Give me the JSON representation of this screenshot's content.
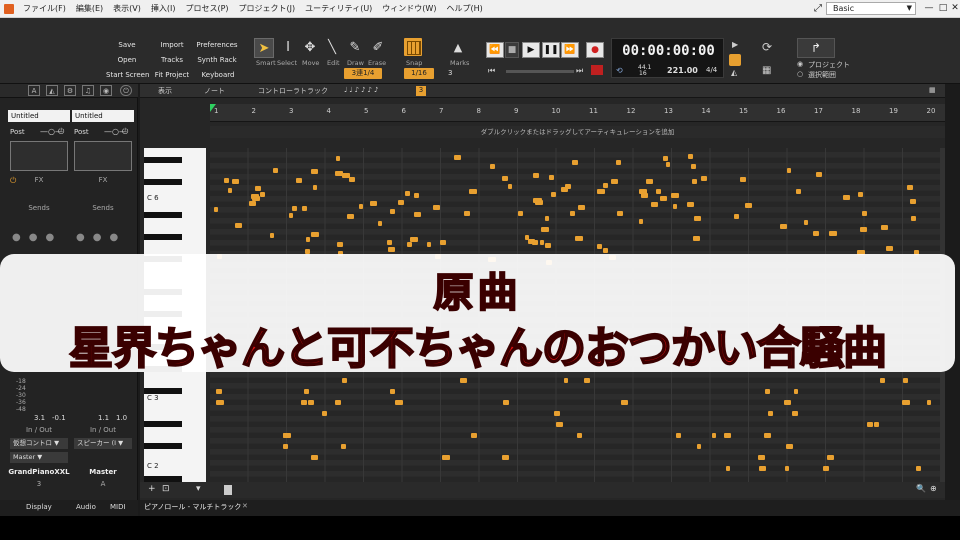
{
  "menubar": {
    "items": [
      "ファイル(F)",
      "編集(E)",
      "表示(V)",
      "挿入(I)",
      "プロセス(P)",
      "プロジェクト(J)",
      "ユーティリティ(U)",
      "ウィンドウ(W)",
      "ヘルプ(H)"
    ],
    "workspace": "Basic"
  },
  "controlbar": {
    "module_buttons": [
      "Save",
      "Import",
      "Preferences",
      "Open",
      "Tracks",
      "Synth Rack",
      "Start Screen",
      "Fit Project",
      "Keyboard"
    ],
    "tools": [
      "Smart",
      "Select",
      "Move",
      "Edit",
      "Draw",
      "Erase"
    ],
    "tool_setting": "3連1/4",
    "snap_label": "Snap",
    "snap_value": "1/16",
    "snap_count": "3",
    "marks_label": "Marks",
    "time": "00:00:00:00",
    "sample_rate": "44.1",
    "bit_depth": "16",
    "tempo": "221.00",
    "meter": "4/4",
    "scope_project": "プロジェクト",
    "scope_selection": "選択範囲",
    "brand": "cakewalk"
  },
  "inspector": {
    "strips": [
      {
        "name": "Untitled",
        "post": "Post",
        "fx": "FX",
        "sends": "Sends",
        "val_left": "3.1",
        "val_right": "-0.1",
        "io_label": "In / Out",
        "input": "仮想コントロ ▼",
        "output": "Master ▼",
        "track": "GrandPianoXXL",
        "number": "3"
      },
      {
        "name": "Untitled",
        "post": "Post",
        "fx": "FX",
        "sends": "Sends",
        "val_left": "1.1",
        "val_right": "1.0",
        "io_label": "In / Out",
        "input": "スピーカー (I ▼",
        "output": "",
        "track": "Master",
        "number": "A"
      }
    ],
    "db_marks": [
      "-18",
      "-24",
      "-30",
      "-36",
      "-48"
    ],
    "bottom_tabs": [
      "Display",
      "Audio",
      "MIDI"
    ]
  },
  "pianoroll": {
    "menus": [
      "表示",
      "ノート",
      "コントローラ",
      "トラック"
    ],
    "ruler": [
      "1",
      "2",
      "3",
      "4",
      "5",
      "6",
      "7",
      "8",
      "9",
      "10",
      "11",
      "12",
      "13",
      "14",
      "15",
      "16",
      "17",
      "18",
      "19",
      "20"
    ],
    "articulation_hint": "ダブルクリックまたはドラッグしてアーティキュレーションを追加",
    "key_labels": [
      "C 6",
      "C 3",
      "C 2"
    ],
    "tab_title": "ピアノロール - マルチトラック"
  },
  "caption": {
    "title": "原曲",
    "subtitle": "星界ちゃんと可不ちゃんのおつかい合騒曲"
  }
}
